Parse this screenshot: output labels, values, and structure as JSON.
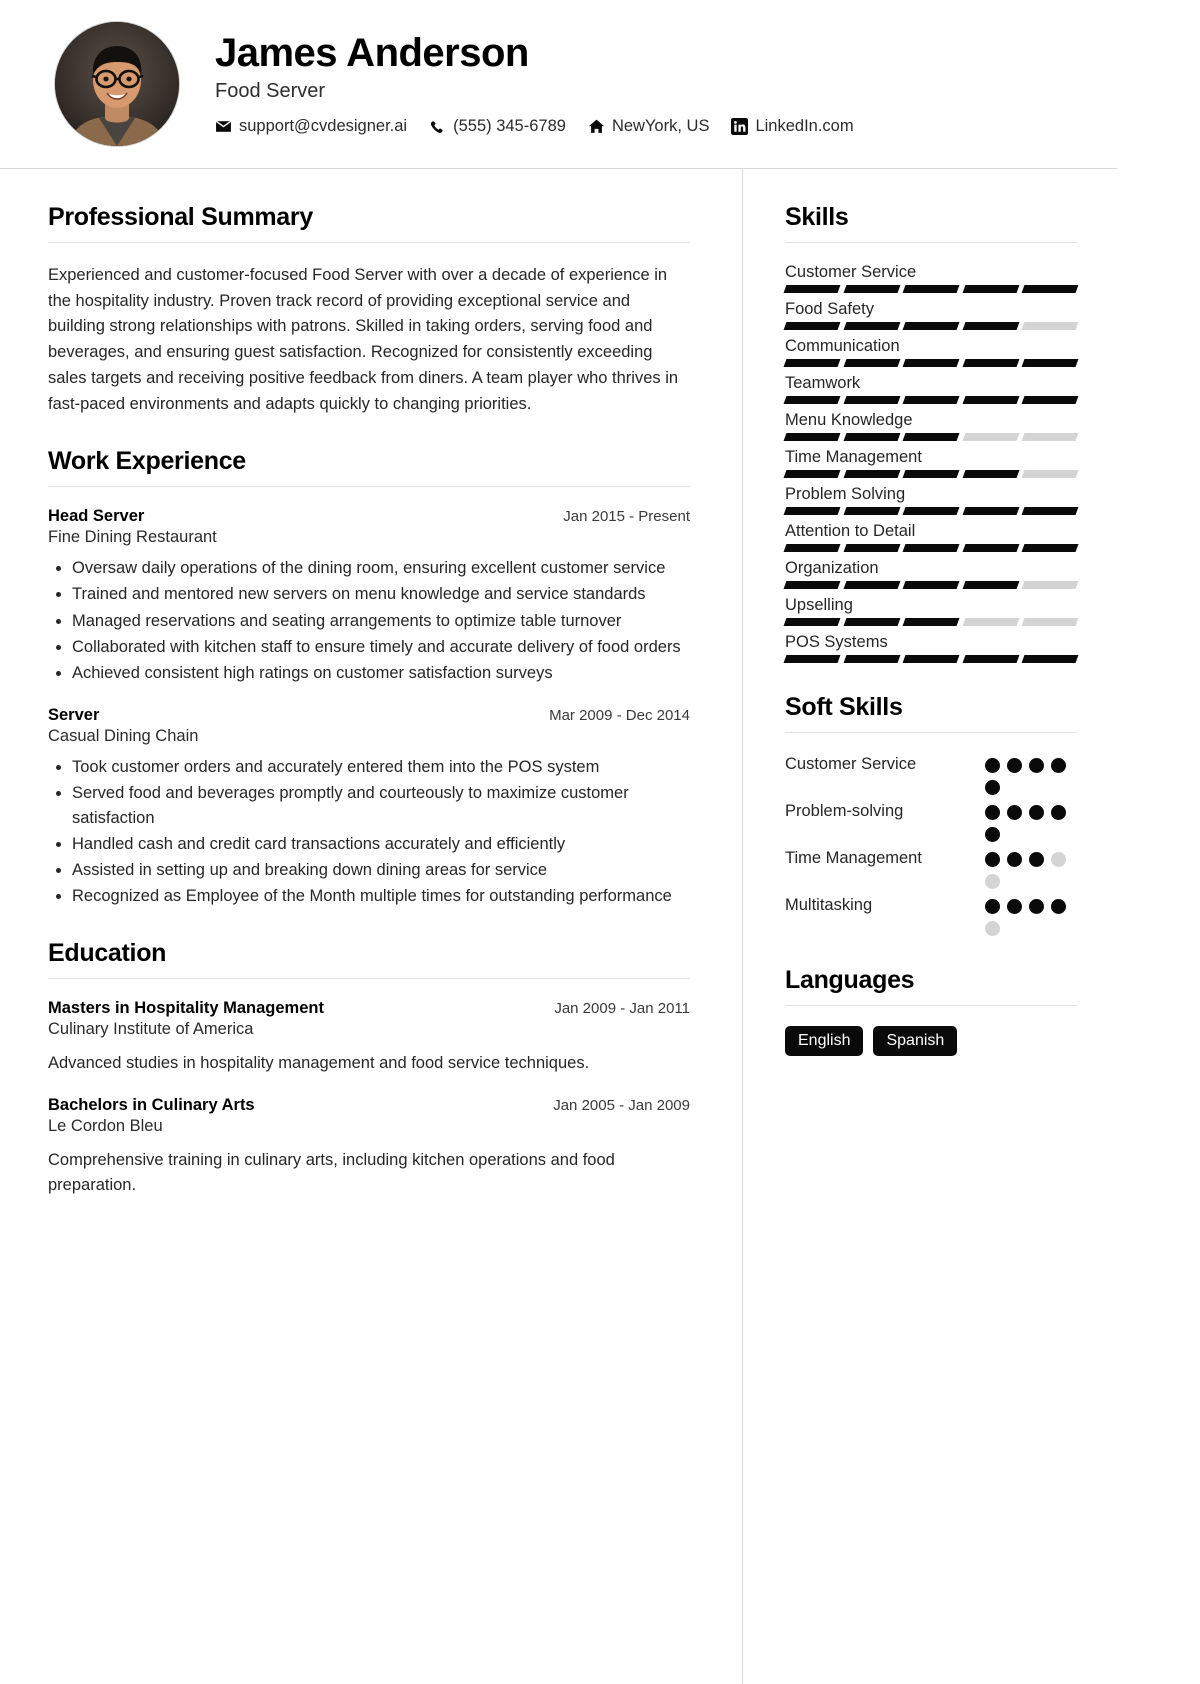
{
  "header": {
    "name": "James Anderson",
    "job_title": "Food Server",
    "avatar_alt": "profile-photo",
    "contacts": [
      {
        "icon": "email-icon",
        "text": "support@cvdesigner.ai"
      },
      {
        "icon": "phone-icon",
        "text": "(555) 345-6789"
      },
      {
        "icon": "home-icon",
        "text": "NewYork, US"
      },
      {
        "icon": "linkedin-icon",
        "text": "LinkedIn.com"
      }
    ]
  },
  "main": {
    "summary": {
      "title": "Professional Summary",
      "text": "Experienced and customer-focused Food Server with over a decade of experience in the hospitality industry. Proven track record of providing exceptional service and building strong relationships with patrons. Skilled in taking orders, serving food and beverages, and ensuring guest satisfaction. Recognized for consistently exceeding sales targets and receiving positive feedback from diners. A team player who thrives in fast-paced environments and adapts quickly to changing priorities."
    },
    "work": {
      "title": "Work Experience",
      "entries": [
        {
          "role": "Head Server",
          "date": "Jan 2015 - Present",
          "company": "Fine Dining Restaurant",
          "bullets": [
            "Oversaw daily operations of the dining room, ensuring excellent customer service",
            "Trained and mentored new servers on menu knowledge and service standards",
            "Managed reservations and seating arrangements to optimize table turnover",
            "Collaborated with kitchen staff to ensure timely and accurate delivery of food orders",
            "Achieved consistent high ratings on customer satisfaction surveys"
          ]
        },
        {
          "role": "Server",
          "date": "Mar 2009 - Dec 2014",
          "company": "Casual Dining Chain",
          "bullets": [
            "Took customer orders and accurately entered them into the POS system",
            "Served food and beverages promptly and courteously to maximize customer satisfaction",
            "Handled cash and credit card transactions accurately and efficiently",
            "Assisted in setting up and breaking down dining areas for service",
            "Recognized as Employee of the Month multiple times for outstanding performance"
          ]
        }
      ]
    },
    "education": {
      "title": "Education",
      "entries": [
        {
          "degree": "Masters in Hospitality Management",
          "date": "Jan 2009 - Jan 2011",
          "school": "Culinary Institute of America",
          "description": "Advanced studies in hospitality management and food service techniques."
        },
        {
          "degree": "Bachelors in Culinary Arts",
          "date": "Jan 2005 - Jan 2009",
          "school": "Le Cordon Bleu",
          "description": "Comprehensive training in culinary arts, including kitchen operations and food preparation."
        }
      ]
    }
  },
  "sidebar": {
    "skills": {
      "title": "Skills",
      "max_segments": 5,
      "items": [
        {
          "name": "Customer Service",
          "level": 5
        },
        {
          "name": "Food Safety",
          "level": 4
        },
        {
          "name": "Communication",
          "level": 5
        },
        {
          "name": "Teamwork",
          "level": 5
        },
        {
          "name": "Menu Knowledge",
          "level": 3
        },
        {
          "name": "Time Management",
          "level": 4
        },
        {
          "name": "Problem Solving",
          "level": 5
        },
        {
          "name": "Attention to Detail",
          "level": 5
        },
        {
          "name": "Organization",
          "level": 4
        },
        {
          "name": "Upselling",
          "level": 3
        },
        {
          "name": "POS Systems",
          "level": 5
        }
      ]
    },
    "soft_skills": {
      "title": "Soft Skills",
      "max_dots": 5,
      "items": [
        {
          "name": "Customer Service",
          "level": 5
        },
        {
          "name": "Problem-solving",
          "level": 5
        },
        {
          "name": "Time Management",
          "level": 3
        },
        {
          "name": "Multitasking",
          "level": 4
        }
      ]
    },
    "languages": {
      "title": "Languages",
      "items": [
        "English",
        "Spanish"
      ]
    }
  },
  "colors": {
    "ink": "#0a0a0a",
    "muted": "#d4d4d4",
    "rule": "#e2e2e2"
  }
}
